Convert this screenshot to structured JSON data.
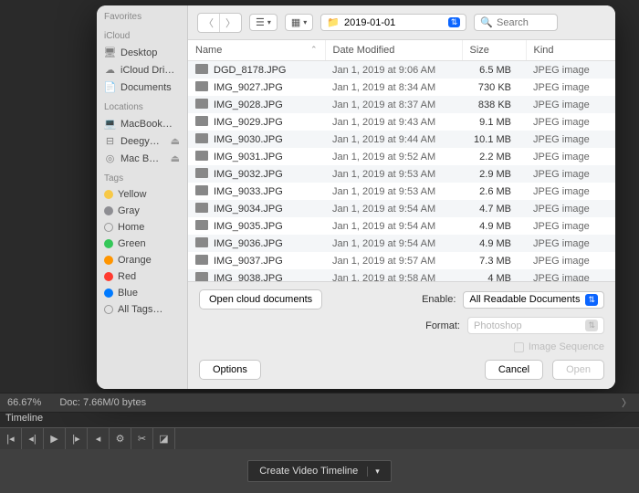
{
  "sidebar": {
    "favorites_heading": "Favorites",
    "icloud_heading": "iCloud",
    "icloud_items": [
      {
        "icon": "desktop",
        "label": "Desktop"
      },
      {
        "icon": "cloud",
        "label": "iCloud Dri…"
      },
      {
        "icon": "doc",
        "label": "Documents"
      }
    ],
    "locations_heading": "Locations",
    "locations_items": [
      {
        "icon": "laptop",
        "label": "MacBook…"
      },
      {
        "icon": "disk",
        "label": "Deegy…",
        "eject": true
      },
      {
        "icon": "disc",
        "label": "Mac B…",
        "eject": true
      }
    ],
    "tags_heading": "Tags",
    "tags": [
      {
        "color": "#f7c948",
        "label": "Yellow"
      },
      {
        "color": "#8e8e93",
        "label": "Gray"
      },
      {
        "color": "transparent",
        "stroke": "#999",
        "label": "Home"
      },
      {
        "color": "#34c759",
        "label": "Green"
      },
      {
        "color": "#ff9500",
        "label": "Orange"
      },
      {
        "color": "#ff3b30",
        "label": "Red"
      },
      {
        "color": "#007aff",
        "label": "Blue"
      },
      {
        "color": "transparent",
        "stroke": "#999",
        "label": "All Tags…"
      }
    ]
  },
  "toolbar": {
    "folder_name": "2019-01-01",
    "search_placeholder": "Search"
  },
  "columns": {
    "name": "Name",
    "date": "Date Modified",
    "size": "Size",
    "kind": "Kind"
  },
  "files": [
    {
      "name": "DGD_8178.JPG",
      "date": "Jan 1, 2019 at 9:06 AM",
      "size": "6.5 MB",
      "kind": "JPEG image"
    },
    {
      "name": "IMG_9027.JPG",
      "date": "Jan 1, 2019 at 8:34 AM",
      "size": "730 KB",
      "kind": "JPEG image"
    },
    {
      "name": "IMG_9028.JPG",
      "date": "Jan 1, 2019 at 8:37 AM",
      "size": "838 KB",
      "kind": "JPEG image"
    },
    {
      "name": "IMG_9029.JPG",
      "date": "Jan 1, 2019 at 9:43 AM",
      "size": "9.1 MB",
      "kind": "JPEG image"
    },
    {
      "name": "IMG_9030.JPG",
      "date": "Jan 1, 2019 at 9:44 AM",
      "size": "10.1 MB",
      "kind": "JPEG image"
    },
    {
      "name": "IMG_9031.JPG",
      "date": "Jan 1, 2019 at 9:52 AM",
      "size": "2.2 MB",
      "kind": "JPEG image"
    },
    {
      "name": "IMG_9032.JPG",
      "date": "Jan 1, 2019 at 9:53 AM",
      "size": "2.9 MB",
      "kind": "JPEG image"
    },
    {
      "name": "IMG_9033.JPG",
      "date": "Jan 1, 2019 at 9:53 AM",
      "size": "2.6 MB",
      "kind": "JPEG image"
    },
    {
      "name": "IMG_9034.JPG",
      "date": "Jan 1, 2019 at 9:54 AM",
      "size": "4.7 MB",
      "kind": "JPEG image"
    },
    {
      "name": "IMG_9035.JPG",
      "date": "Jan 1, 2019 at 9:54 AM",
      "size": "4.9 MB",
      "kind": "JPEG image"
    },
    {
      "name": "IMG_9036.JPG",
      "date": "Jan 1, 2019 at 9:54 AM",
      "size": "4.9 MB",
      "kind": "JPEG image"
    },
    {
      "name": "IMG_9037.JPG",
      "date": "Jan 1, 2019 at 9:57 AM",
      "size": "7.3 MB",
      "kind": "JPEG image"
    },
    {
      "name": "IMG_9038.JPG",
      "date": "Jan 1, 2019 at 9:58 AM",
      "size": "4 MB",
      "kind": "JPEG image"
    }
  ],
  "footer": {
    "cloud_label": "Open cloud documents",
    "enable_label": "Enable:",
    "enable_value": "All Readable Documents",
    "format_label": "Format:",
    "format_value": "Photoshop",
    "sequence_label": "Image Sequence",
    "options_label": "Options",
    "cancel_label": "Cancel",
    "open_label": "Open"
  },
  "status": {
    "zoom": "66.67%",
    "doc": "Doc: 7.66M/0 bytes",
    "timeline_label": "Timeline",
    "create_label": "Create Video Timeline"
  }
}
